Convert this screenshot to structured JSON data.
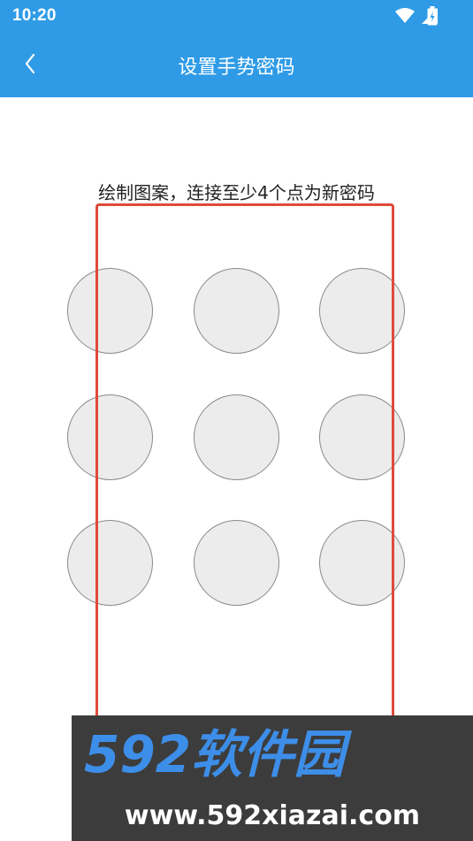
{
  "status_bar": {
    "time": "10:20",
    "icons": [
      "wifi-icon",
      "signal-icon",
      "battery-icon"
    ]
  },
  "app_bar": {
    "title": "设置手势密码",
    "back_icon": "chevron-left-icon",
    "background": "#2f9be6"
  },
  "hint": "绘制图案，连接至少4个点为新密码",
  "pattern": {
    "rows": 3,
    "cols": 3,
    "dot_fill": "#ececec",
    "dot_border": "#8a8a8a"
  },
  "overlay": {
    "highlight_color": "#e04a3a"
  },
  "watermark": {
    "brand": "592软件园",
    "url": "www.592xiazai.com"
  }
}
